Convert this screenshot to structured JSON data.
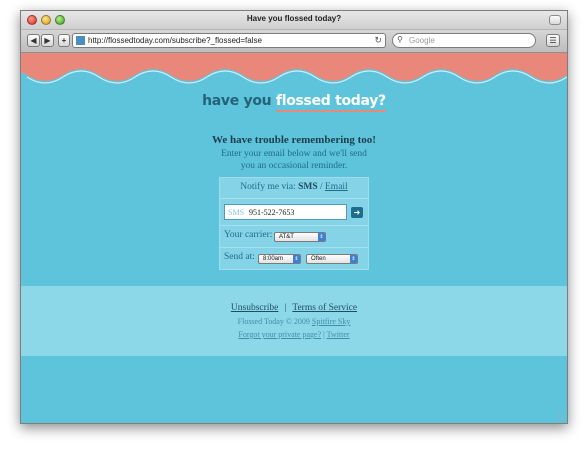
{
  "window": {
    "title": "Have you flossed today?"
  },
  "toolbar": {
    "back_icon": "back-icon",
    "forward_icon": "forward-icon",
    "add_icon": "plus-icon",
    "url": "http://flossedtoday.com/subscribe?_flossed=false",
    "search_placeholder": "Google"
  },
  "page": {
    "logo": {
      "part1": "have you ",
      "part2": "flossed today?"
    },
    "intro": {
      "title": "We have trouble remembering too!",
      "line1": "Enter your email below and we'll send",
      "line2": "you an occasional reminder."
    },
    "form": {
      "notify_label": "Notify me via: ",
      "sms": "SMS",
      "slash": " / ",
      "email": "Email",
      "phone_prefix": "SMS",
      "phone_value": "951-522-7653",
      "submit_icon": "arrow-right-icon",
      "carrier_label": "Your carrier:",
      "carrier_value": "AT&T",
      "send_label": "Send at:",
      "time_value": "8:00am",
      "frequency_value": "Often"
    },
    "footer": {
      "unsubscribe": "Unsubscribe",
      "pipe": "|",
      "terms": "Terms of Service",
      "copyright": "Flossed Today © 2009 ",
      "company": "Spitfire Sky",
      "forgot": "Forgot your private page?",
      "sep": " | ",
      "twitter": "Twitter"
    }
  },
  "colors": {
    "page_bg": "#5ec4dc",
    "wave": "#e8877a",
    "panel": "#84d3e6",
    "footer": "#8dd8e8",
    "accent": "#1d6e8d"
  }
}
